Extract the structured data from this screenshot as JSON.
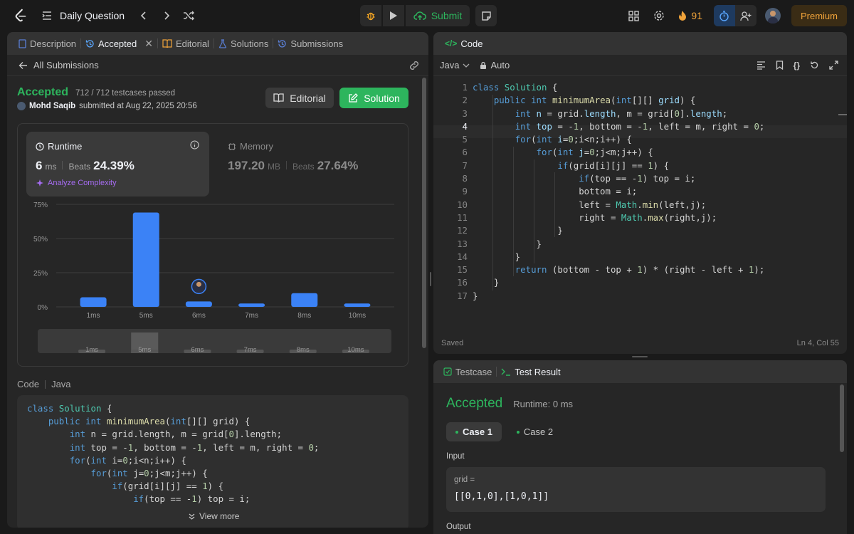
{
  "topbar": {
    "title": "Daily Question",
    "submit_label": "Submit",
    "streak": "91",
    "premium_label": "Premium"
  },
  "left": {
    "tabs": [
      "Description",
      "Accepted",
      "Editorial",
      "Solutions",
      "Submissions"
    ],
    "back_label": "All Submissions",
    "status": "Accepted",
    "testcases": "712 / 712 testcases passed",
    "user": "Mohd Saqib",
    "submitted": "submitted at Aug 22, 2025 20:56",
    "editorial_btn": "Editorial",
    "solution_btn": "Solution",
    "runtime": {
      "label": "Runtime",
      "value": "6",
      "unit": "ms",
      "beats_label": "Beats",
      "beats": "24.39%",
      "analyze": "Analyze Complexity"
    },
    "memory": {
      "label": "Memory",
      "value": "197.20",
      "unit": "MB",
      "beats_label": "Beats",
      "beats": "27.64%"
    },
    "code_label": "Code",
    "code_lang": "Java",
    "view_more": "View more"
  },
  "chart_data": {
    "type": "bar",
    "categories": [
      "1ms",
      "5ms",
      "6ms",
      "7ms",
      "8ms",
      "10ms"
    ],
    "values": [
      7,
      69,
      4,
      2.5,
      10,
      2.5
    ],
    "y_ticks": [
      "75%",
      "50%",
      "25%",
      "0%"
    ],
    "ylim": [
      0,
      75
    ],
    "grid": true,
    "highlight": "6ms",
    "bar_color": "#3b82f6"
  },
  "code": {
    "header": "Code",
    "language": "Java",
    "mode": "Auto",
    "status": "Saved",
    "cursor": "Ln 4, Col 55"
  },
  "bottom": {
    "tab_testcase": "Testcase",
    "tab_result": "Test Result",
    "status": "Accepted",
    "runtime": "Runtime: 0 ms",
    "case1": "Case 1",
    "case2": "Case 2",
    "input_label": "Input",
    "var_label": "grid =",
    "var_value": "[[0,1,0],[1,0,1]]",
    "output_label": "Output"
  },
  "colors": {
    "accent_green": "#2db55d",
    "premium": "#f0a33a",
    "bar": "#3b82f6"
  }
}
